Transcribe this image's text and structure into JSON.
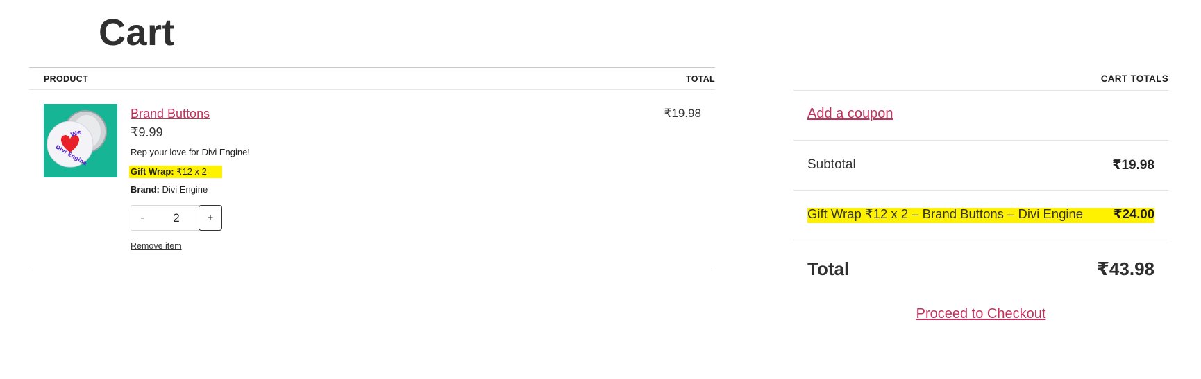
{
  "page": {
    "title": "Cart"
  },
  "cart_table": {
    "headers": {
      "product": "PRODUCT",
      "total": "TOTAL"
    },
    "item": {
      "name": "Brand Buttons",
      "price": "₹9.99",
      "description": "Rep your love for Divi Engine!",
      "gift_wrap_label": "Gift Wrap:",
      "gift_wrap_value": "₹12 x 2",
      "brand_label": "Brand:",
      "brand_value": "Divi Engine",
      "quantity": "2",
      "minus_label": "-",
      "plus_label": "+",
      "remove_label": "Remove item",
      "line_total": "₹19.98",
      "image_text_top": "We",
      "image_text_bottom": "Divi Engine"
    }
  },
  "cart_totals": {
    "heading": "CART TOTALS",
    "coupon_label": "Add a coupon",
    "subtotal_label": "Subtotal",
    "subtotal_value": "₹19.98",
    "fee_label": "Gift Wrap ₹12 x 2 – Brand Buttons – Divi Engine",
    "fee_value": "₹24.00",
    "total_label": "Total",
    "total_value": "₹43.98",
    "checkout_label": "Proceed to Checkout"
  },
  "colors": {
    "link": "#c1325f",
    "highlight": "#fff200",
    "thumb_bg": "#16b596"
  },
  "icons": {
    "product_image": "button-pin-image"
  }
}
